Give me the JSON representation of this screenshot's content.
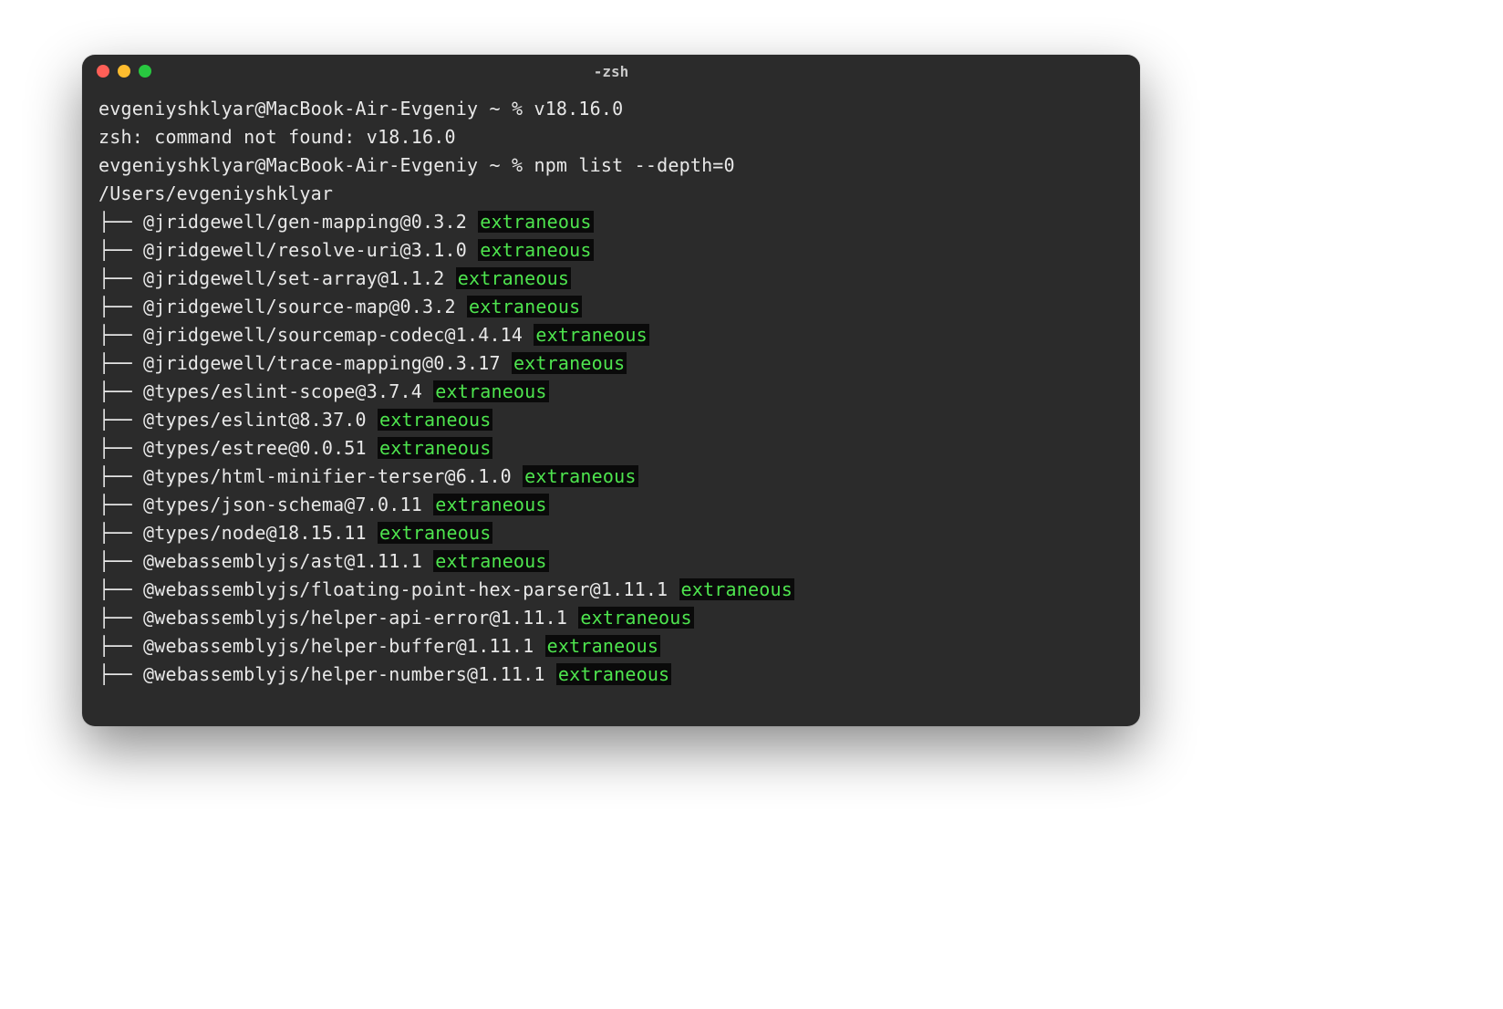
{
  "window": {
    "title": "-zsh"
  },
  "prompt": {
    "user_host": "evgeniyshklyar@MacBook-Air-Evgeniy",
    "path": "~",
    "symbol": "%"
  },
  "lines": {
    "cmd1": "v18.16.0",
    "err1": "zsh: command not found: v18.16.0",
    "cmd2": "npm list --depth=0",
    "root_path": "/Users/evgeniyshklyar"
  },
  "extraneous_label": "extraneous",
  "packages": [
    {
      "name": "@jridgewell/gen-mapping",
      "version": "0.3.2"
    },
    {
      "name": "@jridgewell/resolve-uri",
      "version": "3.1.0"
    },
    {
      "name": "@jridgewell/set-array",
      "version": "1.1.2"
    },
    {
      "name": "@jridgewell/source-map",
      "version": "0.3.2"
    },
    {
      "name": "@jridgewell/sourcemap-codec",
      "version": "1.4.14"
    },
    {
      "name": "@jridgewell/trace-mapping",
      "version": "0.3.17"
    },
    {
      "name": "@types/eslint-scope",
      "version": "3.7.4"
    },
    {
      "name": "@types/eslint",
      "version": "8.37.0"
    },
    {
      "name": "@types/estree",
      "version": "0.0.51"
    },
    {
      "name": "@types/html-minifier-terser",
      "version": "6.1.0"
    },
    {
      "name": "@types/json-schema",
      "version": "7.0.11"
    },
    {
      "name": "@types/node",
      "version": "18.15.11"
    },
    {
      "name": "@webassemblyjs/ast",
      "version": "1.11.1"
    },
    {
      "name": "@webassemblyjs/floating-point-hex-parser",
      "version": "1.11.1"
    },
    {
      "name": "@webassemblyjs/helper-api-error",
      "version": "1.11.1"
    },
    {
      "name": "@webassemblyjs/helper-buffer",
      "version": "1.11.1"
    },
    {
      "name": "@webassemblyjs/helper-numbers",
      "version": "1.11.1"
    }
  ]
}
